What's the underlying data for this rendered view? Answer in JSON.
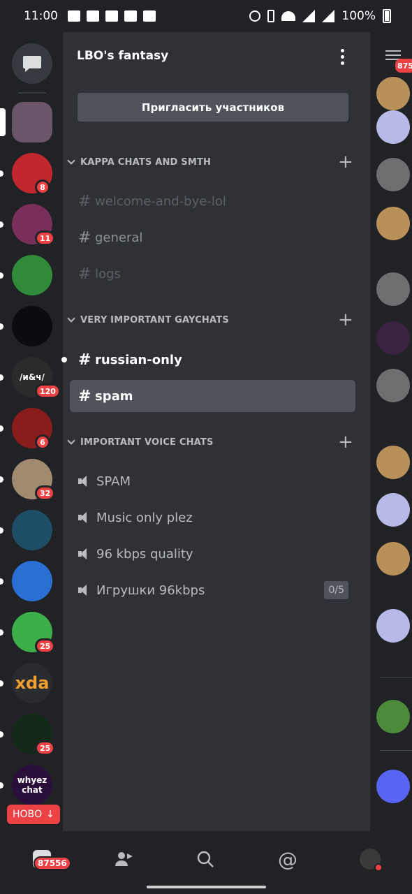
{
  "status_bar": {
    "time": "11:00",
    "battery": "100%"
  },
  "server": {
    "name": "LBO's fantasy",
    "invite_label": "Пригласить участников"
  },
  "categories": [
    {
      "name": "KAPPA CHATS AND SMTH",
      "channels": [
        {
          "name": "welcome-and-bye-lol",
          "state": "muted"
        },
        {
          "name": "general",
          "state": "normal"
        },
        {
          "name": "logs",
          "state": "muted"
        }
      ]
    },
    {
      "name": "VERY IMPORTANT GAYCHATS",
      "channels": [
        {
          "name": "russian-only",
          "state": "unread"
        },
        {
          "name": "spam",
          "state": "selected"
        }
      ]
    },
    {
      "name": "IMPORTANT VOICE CHATS",
      "channels": [
        {
          "name": "SPAM"
        },
        {
          "name": "Music only plez"
        },
        {
          "name": "96 kbps quality"
        },
        {
          "name": "Игрушки 96kbps",
          "user_count": "0/5"
        }
      ]
    }
  ],
  "guilds": [
    {
      "badge": "",
      "color": "#6b5568"
    },
    {
      "badge": "8",
      "color": "#c0282e"
    },
    {
      "badge": "11",
      "color": "#7a2e5a"
    },
    {
      "badge": "",
      "color": "#2f8a3a"
    },
    {
      "badge": "",
      "color": "#0b0b12"
    },
    {
      "badge": "120",
      "label": "/и&ч/",
      "color": "#2b2b2b"
    },
    {
      "badge": "6",
      "color": "#8a1c1c"
    },
    {
      "badge": "32",
      "color": "#a08a70"
    },
    {
      "badge": "",
      "color": "#1d4e66"
    },
    {
      "badge": "",
      "color": "#2a6fd1"
    },
    {
      "badge": "25",
      "color": "#3cae4a"
    },
    {
      "badge": "",
      "label": "xda",
      "color": "#2a2b2f"
    },
    {
      "badge": "25",
      "color": "#142a18"
    },
    {
      "badge": "",
      "label": "whyez chat",
      "color": "#2a0f3a"
    }
  ],
  "new_pill": "НОВО",
  "peek_badge": "875",
  "nav": {
    "home_badge": "87556"
  },
  "colors": {
    "accent": "#5865f2",
    "danger": "#ed4245",
    "background": "#2f3136"
  }
}
